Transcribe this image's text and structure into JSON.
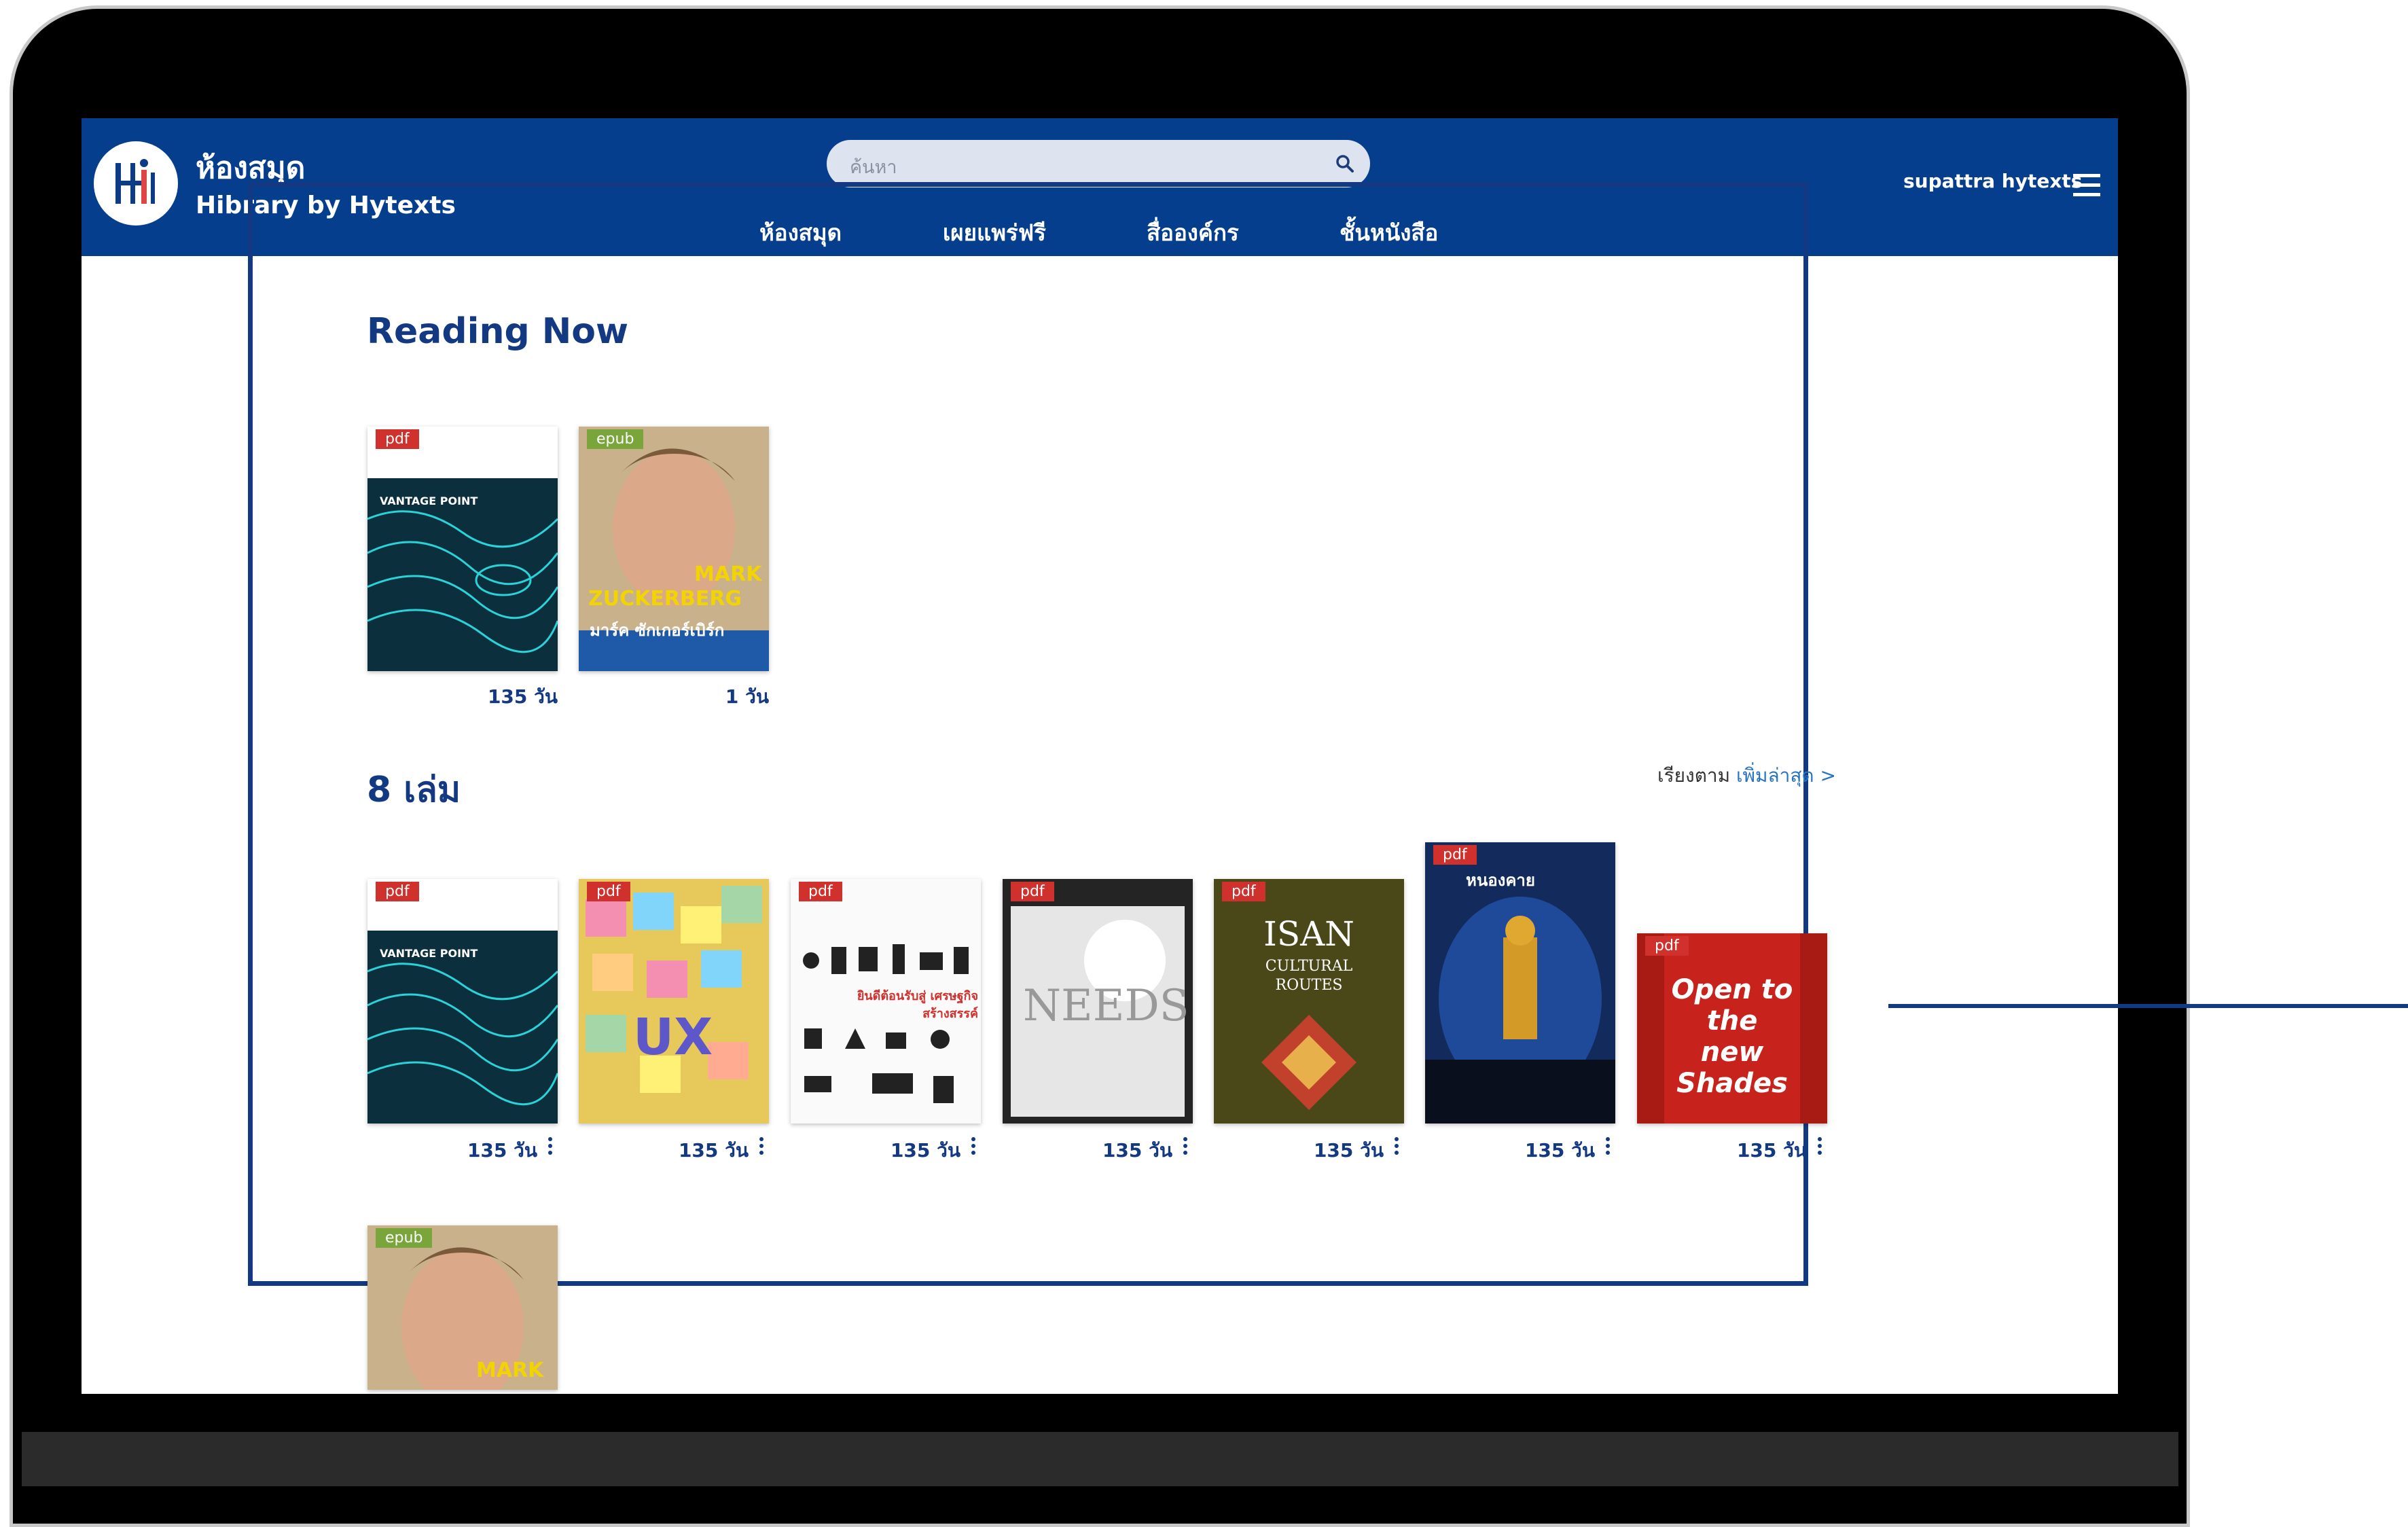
{
  "header": {
    "title": "ห้องสมุด",
    "subtitle": "Hibrary by Hytexts",
    "search_placeholder": "ค้นหา",
    "nav": [
      {
        "label": "ห้องสมุด"
      },
      {
        "label": "เผยแพร่ฟรี"
      },
      {
        "label": "สื่อองค์กร"
      },
      {
        "label": "ชั้นหนังสือ"
      }
    ],
    "user_name": "supattra hytexts",
    "icons": {
      "logo": "hibrary-logo-icon",
      "search": "search-icon",
      "menu": "hamburger-menu-icon"
    }
  },
  "reading_now": {
    "title": "Reading Now",
    "books": [
      {
        "format": "pdf",
        "days": "135 วัน",
        "cover": "vantage-point"
      },
      {
        "format": "epub",
        "days": "1 วัน",
        "cover": "zuckerberg"
      }
    ]
  },
  "shelf": {
    "title": "8 เล่ม",
    "sort_label": "เรียงตาม",
    "sort_value": "เพิ่มล่าสุด >",
    "books": [
      {
        "format": "pdf",
        "days": "135 วัน",
        "cover": "vantage-point"
      },
      {
        "format": "pdf",
        "days": "135 วัน",
        "cover": "ux"
      },
      {
        "format": "pdf",
        "days": "135 วัน",
        "cover": "creative-economy"
      },
      {
        "format": "pdf",
        "days": "135 วัน",
        "cover": "needs"
      },
      {
        "format": "pdf",
        "days": "135 วัน",
        "cover": "isan"
      },
      {
        "format": "pdf",
        "days": "135 วัน",
        "cover": "nong-khai"
      },
      {
        "format": "pdf",
        "days": "135 วัน",
        "cover": "open-to-new-shades"
      },
      {
        "format": "epub",
        "days": "",
        "cover": "zuckerberg"
      }
    ]
  },
  "covers": {
    "vantage_point": "VANTAGE POINT",
    "zuckerberg_line1": "MARK",
    "zuckerberg_line2": "ZUCKERBERG",
    "zuckerberg_thai": "มาร์ค ซักเกอร์เบิร์ก",
    "ux": "UX",
    "creative_thai": "ยินดีต้อนรับสู่ เศรษฐกิจสร้างสรรค์",
    "needs": "NEEDS",
    "isan_line1": "ISAN",
    "isan_line2": "CULTURAL",
    "isan_line3": "ROUTES",
    "nongkhai": "หนองคาย",
    "shades": "Open to the new Shades"
  },
  "colors": {
    "brand": "#043e8d",
    "frame": "#133983",
    "pdf_tag": "#d0312d",
    "epub_tag": "#7aa53b",
    "sort_link": "#2573c4"
  }
}
